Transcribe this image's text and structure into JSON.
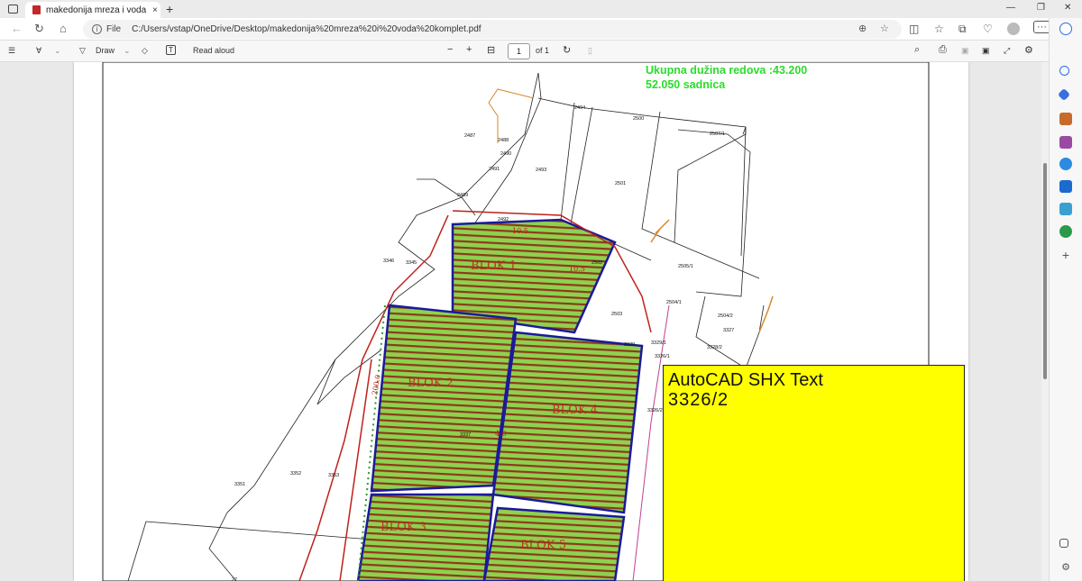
{
  "tab": {
    "title": "makedonija mreza i voda komplet",
    "close": "×",
    "new_tab": "+"
  },
  "window": {
    "minimize": "—",
    "maximize": "❐",
    "close": "✕"
  },
  "address": {
    "back": "←",
    "refresh": "↻",
    "home": "⌂",
    "scheme_label": "File",
    "url": "C:/Users/vstap/OneDrive/Desktop/makedonija%20mreza%20i%20voda%20komplet.pdf",
    "more": "···"
  },
  "pdf_toolbar": {
    "contents": "☰",
    "highlight": "∀",
    "draw_label": "Draw",
    "erase": "◇",
    "text": "T",
    "read_aloud_label": "Read aloud",
    "zoom_out": "−",
    "zoom_in": "+",
    "fit": "⊟",
    "page_value": "1",
    "page_of": "of 1",
    "rotate": "↻",
    "print": "⎙",
    "search": "⌕",
    "settings": "⚙"
  },
  "document": {
    "green_line1": "Ukupna dužina redova :43.200",
    "green_line2": "52.050 sadnica",
    "tooltip_title": "AutoCAD SHX Text",
    "tooltip_value": "3326/2",
    "parcels": [
      "2494",
      "2500",
      "2507/1",
      "2487",
      "2488",
      "2490",
      "2493",
      "2491",
      "2501",
      "2489",
      "2492",
      "10.5",
      "3346",
      "3345",
      "2502",
      "2505/1",
      "2504/1",
      "2503",
      "2504/2",
      "3327",
      "3328/2",
      "3329/1",
      "3330",
      "3326/1",
      "3326/2",
      "3351",
      "3352",
      "3353",
      "3337",
      "27",
      "4.0",
      "10.5",
      "200.0"
    ],
    "blocks": [
      "BLOK 1",
      "BLOK 2",
      "BLOK 3",
      "BLOK 4",
      "BLOK 5"
    ]
  },
  "colors": {
    "green_text": "#2bdc2b",
    "tooltip_bg": "#ffff00",
    "rows": "#8b3a1a",
    "crop": "#8fd14f",
    "boundary": "#1a1a9a"
  }
}
